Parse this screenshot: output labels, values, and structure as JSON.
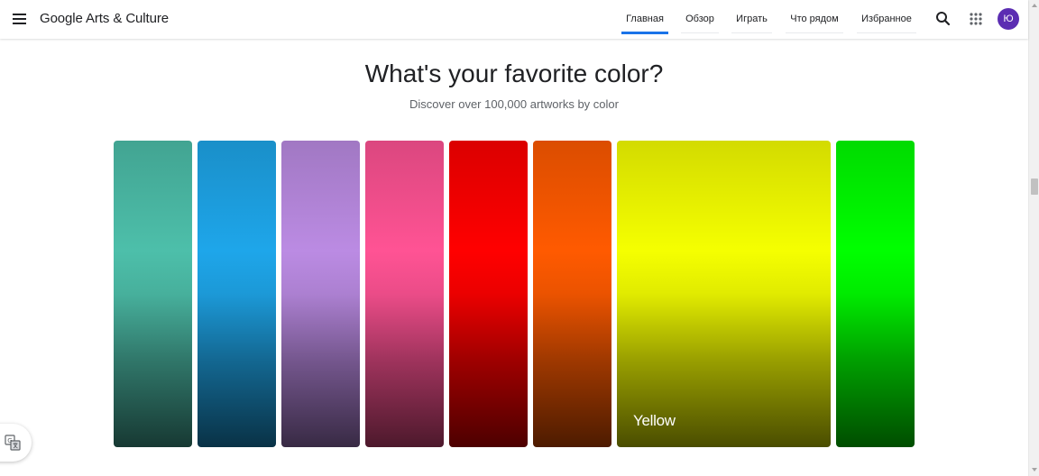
{
  "header": {
    "logo": "Google Arts & Culture",
    "nav": [
      {
        "label": "Главная",
        "active": true
      },
      {
        "label": "Обзор",
        "active": false
      },
      {
        "label": "Играть",
        "active": false
      },
      {
        "label": "Что рядом",
        "active": false
      },
      {
        "label": "Избранное",
        "active": false
      }
    ],
    "icons": {
      "menu": "hamburger-menu-icon",
      "search": "search-icon",
      "apps": "apps-grid-icon"
    },
    "avatar_letter": "Ю"
  },
  "main": {
    "title": "What's your favorite color?",
    "subtitle": "Discover over 100,000 artworks by color",
    "swatches": [
      {
        "color": "#4dbfaa",
        "name": ""
      },
      {
        "color": "#1ea6ea",
        "name": ""
      },
      {
        "color": "#bb8be3",
        "name": ""
      },
      {
        "color": "#ff5394",
        "name": ""
      },
      {
        "color": "#ff0000",
        "name": ""
      },
      {
        "color": "#ff5a00",
        "name": ""
      },
      {
        "color": "#f5ff00",
        "name": "Yellow"
      },
      {
        "color": "#00ff00",
        "name": ""
      }
    ]
  },
  "translate": {
    "icon": "translate-icon"
  }
}
